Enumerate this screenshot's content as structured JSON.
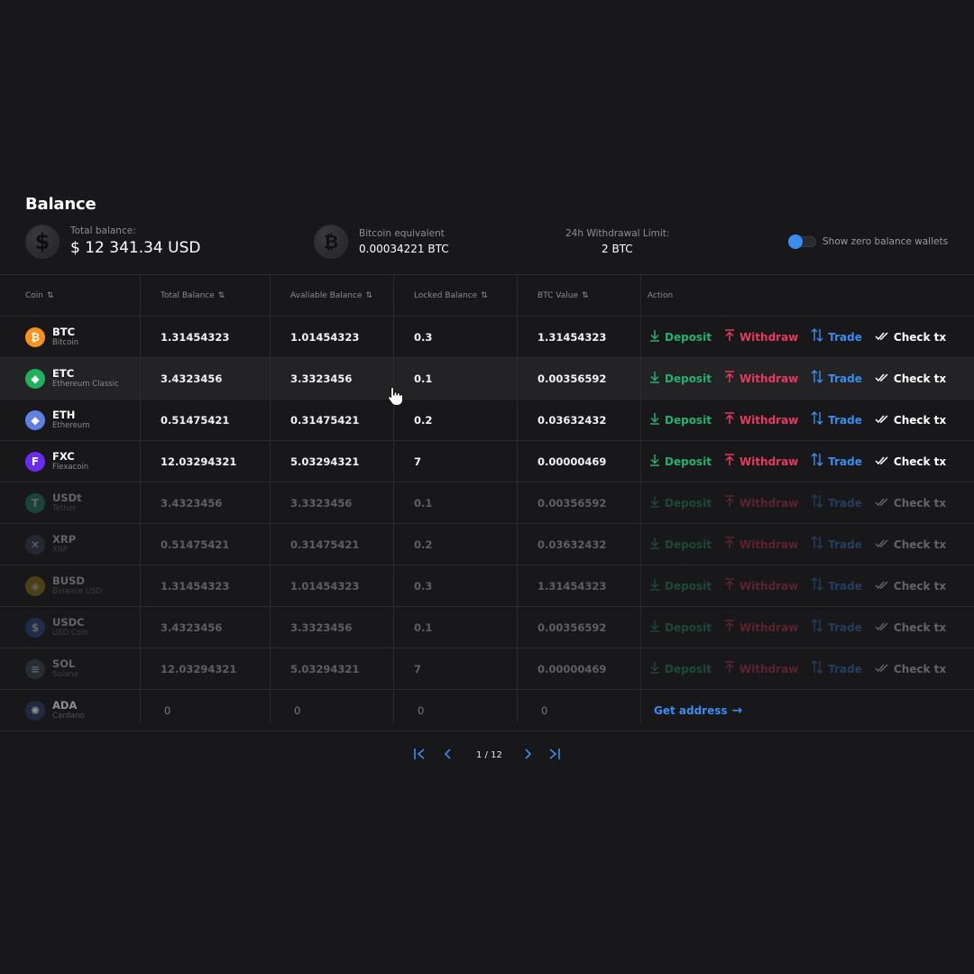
{
  "page": {
    "title": "Balance"
  },
  "summary": {
    "total_label": "Total balance:",
    "total_value": "$ 12 341.34 USD",
    "btc_label": "Bitcoin equivalent",
    "btc_value": "0.00034221 BTC",
    "limit_label": "24h Withdrawal Limit:",
    "limit_value": "2 BTC",
    "toggle_label": "Show zero balance wallets",
    "toggle_on": true
  },
  "table": {
    "headers": [
      "Coin",
      "Total Balance",
      "Avaliable Balance",
      "Locked Balance",
      "BTC Value",
      "Action"
    ],
    "sort_icon": "⇅",
    "actions": {
      "deposit": "Deposit",
      "withdraw": "Withdraw",
      "trade": "Trade",
      "check": "Check tx",
      "get_address": "Get address"
    },
    "rows": [
      {
        "symbol": "BTC",
        "name": "Bitcoin",
        "glyph": "₿",
        "color": "#f7931a",
        "total": "1.31454323",
        "available": "1.01454323",
        "locked": "0.3",
        "btc": "1.31454323"
      },
      {
        "symbol": "ETC",
        "name": "Ethereum Classic",
        "glyph": "◆",
        "color": "#1fb15c",
        "total": "3.4323456",
        "available": "3.3323456",
        "locked": "0.1",
        "btc": "0.00356592"
      },
      {
        "symbol": "ETH",
        "name": "Ethereum",
        "glyph": "◆",
        "color": "#5f7fe5",
        "total": "0.51475421",
        "available": "0.31475421",
        "locked": "0.2",
        "btc": "0.03632432"
      },
      {
        "symbol": "FXC",
        "name": "Flexacoin",
        "glyph": "F",
        "color": "#6a2cf0",
        "total": "12.03294321",
        "available": "5.03294321",
        "locked": "7",
        "btc": "0.00000469"
      },
      {
        "symbol": "USDt",
        "name": "Tether",
        "glyph": "T",
        "color": "#23a07a",
        "total": "3.4323456",
        "available": "3.3323456",
        "locked": "0.1",
        "btc": "0.00356592"
      },
      {
        "symbol": "XRP",
        "name": "XRP",
        "glyph": "✕",
        "color": "#3a4a6a",
        "total": "0.51475421",
        "available": "0.31475421",
        "locked": "0.2",
        "btc": "0.03632432"
      },
      {
        "symbol": "BUSD",
        "name": "Binance USD",
        "glyph": "◈",
        "color": "#b8920e",
        "total": "1.31454323",
        "available": "1.01454323",
        "locked": "0.3",
        "btc": "1.31454323"
      },
      {
        "symbol": "USDC",
        "name": "USD Coin",
        "glyph": "$",
        "color": "#2d5db0",
        "total": "3.4323456",
        "available": "3.3323456",
        "locked": "0.1",
        "btc": "0.00356592"
      },
      {
        "symbol": "SOL",
        "name": "Solana",
        "glyph": "≡",
        "color": "#4a5a6a",
        "total": "12.03294321",
        "available": "5.03294321",
        "locked": "7",
        "btc": "0.00000469"
      },
      {
        "symbol": "ADA",
        "name": "Cardano",
        "glyph": "✺",
        "color": "#263a66",
        "total": "0",
        "available": "0",
        "locked": "0",
        "btc": "0"
      }
    ]
  },
  "pagination": {
    "label": "1 / 12",
    "current_page": 1,
    "total_pages": 12
  },
  "icons": {
    "dollar": "dollar-coin-icon",
    "bitcoin": "bitcoin-coin-icon",
    "deposit": "download-arrow-icon",
    "withdraw": "upload-arrow-icon",
    "trade": "swap-arrows-icon",
    "check": "double-check-icon",
    "first": "first-page-icon",
    "prev": "prev-page-icon",
    "next": "next-page-icon",
    "last": "last-page-icon",
    "cursor": "hand-cursor-icon"
  },
  "colors": {
    "deposit": "#25b06f",
    "withdraw": "#e8395f",
    "trade": "#3a8df0",
    "accent": "#3a8df0",
    "background": "#18181a"
  }
}
